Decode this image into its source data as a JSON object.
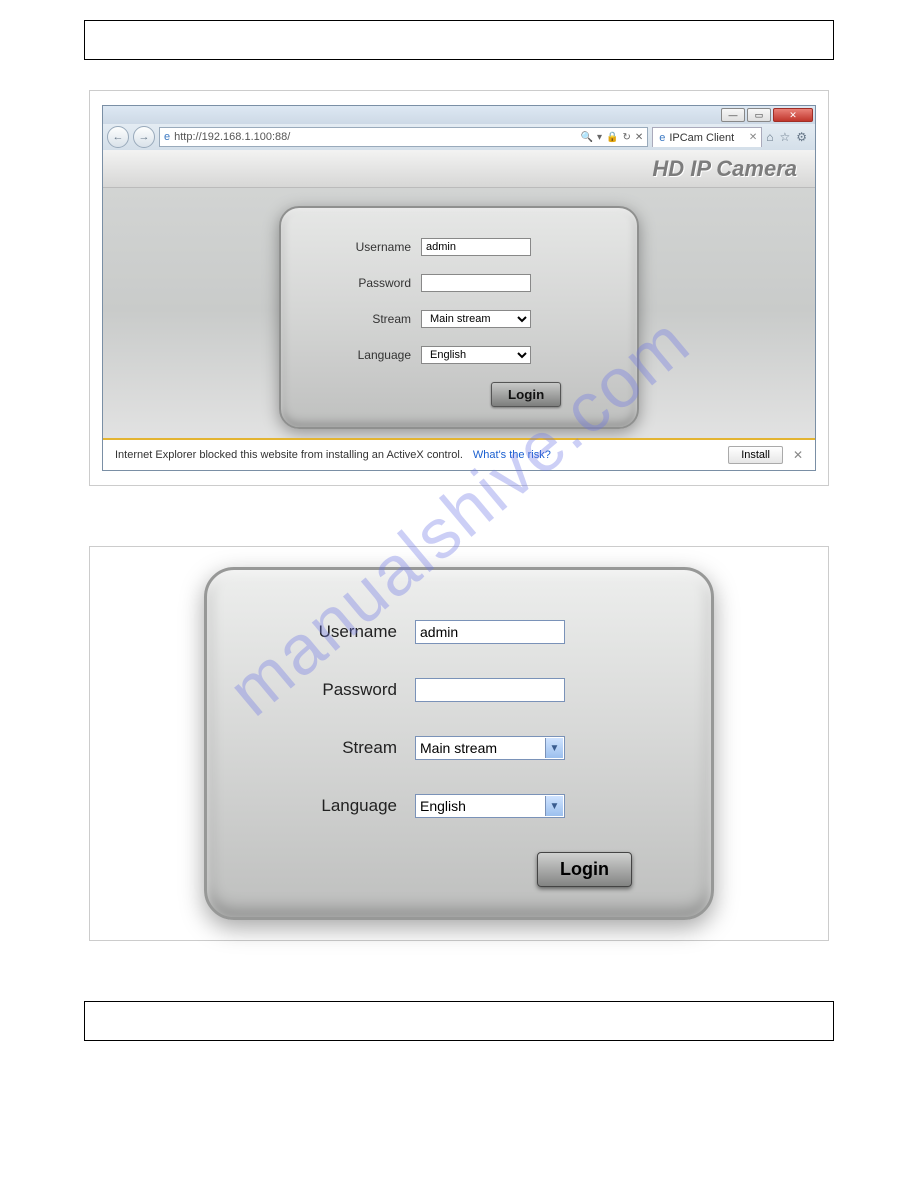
{
  "browser": {
    "url": "http://192.168.1.100:88/",
    "search_hint": "🔎",
    "refresh_hint": "↻",
    "stop_hint": "✕",
    "tab_title": "IPCam Client",
    "window_min": "—",
    "window_max": "▭",
    "window_close": "✕"
  },
  "page": {
    "title": "HD IP Camera"
  },
  "form": {
    "username_label": "Username",
    "username_value": "admin",
    "password_label": "Password",
    "password_value": "",
    "stream_label": "Stream",
    "stream_value": "Main stream",
    "language_label": "Language",
    "language_value": "English",
    "login_button": "Login"
  },
  "activex": {
    "message": "Internet Explorer blocked this website from installing an ActiveX control.",
    "risk_link": "What's the risk?",
    "install_button": "Install",
    "close": "✕"
  },
  "watermark": "manualshive.com"
}
